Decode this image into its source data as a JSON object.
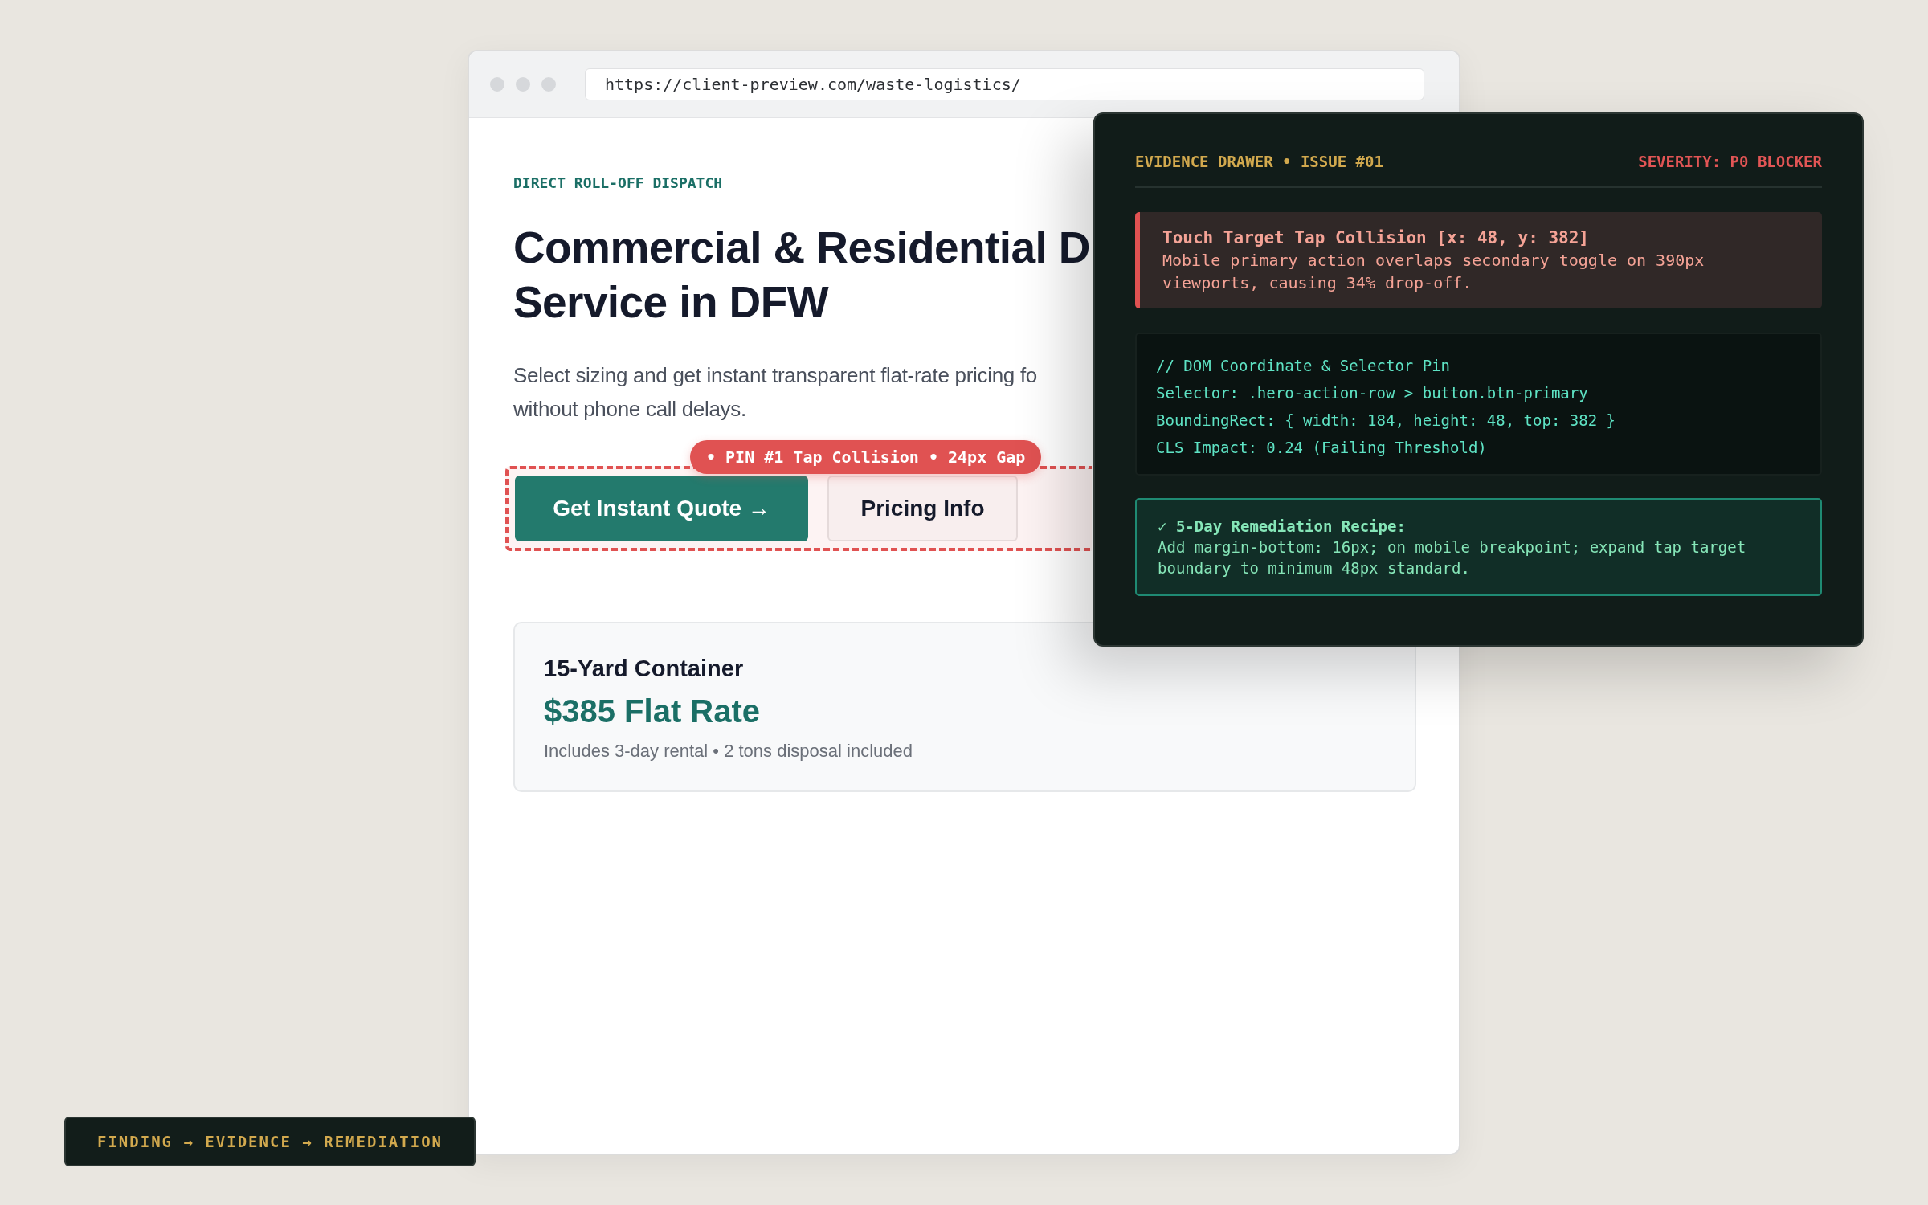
{
  "browser": {
    "url": "https://client-preview.com/waste-logistics/"
  },
  "page": {
    "eyebrow": "DIRECT ROLL-OFF DISPATCH",
    "heading_lines": [
      "Commercial & Residential D",
      "Service in DFW"
    ],
    "lead_lines": [
      "Select sizing and get instant transparent flat-rate pricing fo",
      "without phone call delays."
    ],
    "buttons": [
      {
        "label": "Get Instant Quote →",
        "kind": "primary"
      },
      {
        "label": "Pricing Info",
        "kind": "secondary"
      }
    ],
    "pin": "• PIN #1 Tap Collision • 24px Gap",
    "card": {
      "title": "15-Yard Container",
      "price": "$385 Flat Rate",
      "note": "Includes 3-day rental • 2 tons disposal included"
    }
  },
  "drawer": {
    "title": "EVIDENCE DRAWER • ISSUE #01",
    "severity": "SEVERITY: P0 BLOCKER",
    "finding": {
      "title": "Touch Target Tap Collision [x: 48, y: 382]",
      "text": "Mobile primary action overlaps secondary toggle on 390px viewports, causing 34% drop-off."
    },
    "code_lines": [
      "// DOM Coordinate & Selector Pin",
      "Selector: .hero-action-row > button.btn-primary",
      "BoundingRect: { width: 184, height: 48, top: 382 }",
      "CLS Impact: 0.24 (Failing Threshold)"
    ],
    "remedy": {
      "title": "✓ 5-Day Remediation Recipe:",
      "text": "Add margin-bottom: 16px; on mobile breakpoint; expand tap target boundary to minimum 48px standard."
    }
  },
  "flow_badge": "FINDING → EVIDENCE → REMEDIATION"
}
